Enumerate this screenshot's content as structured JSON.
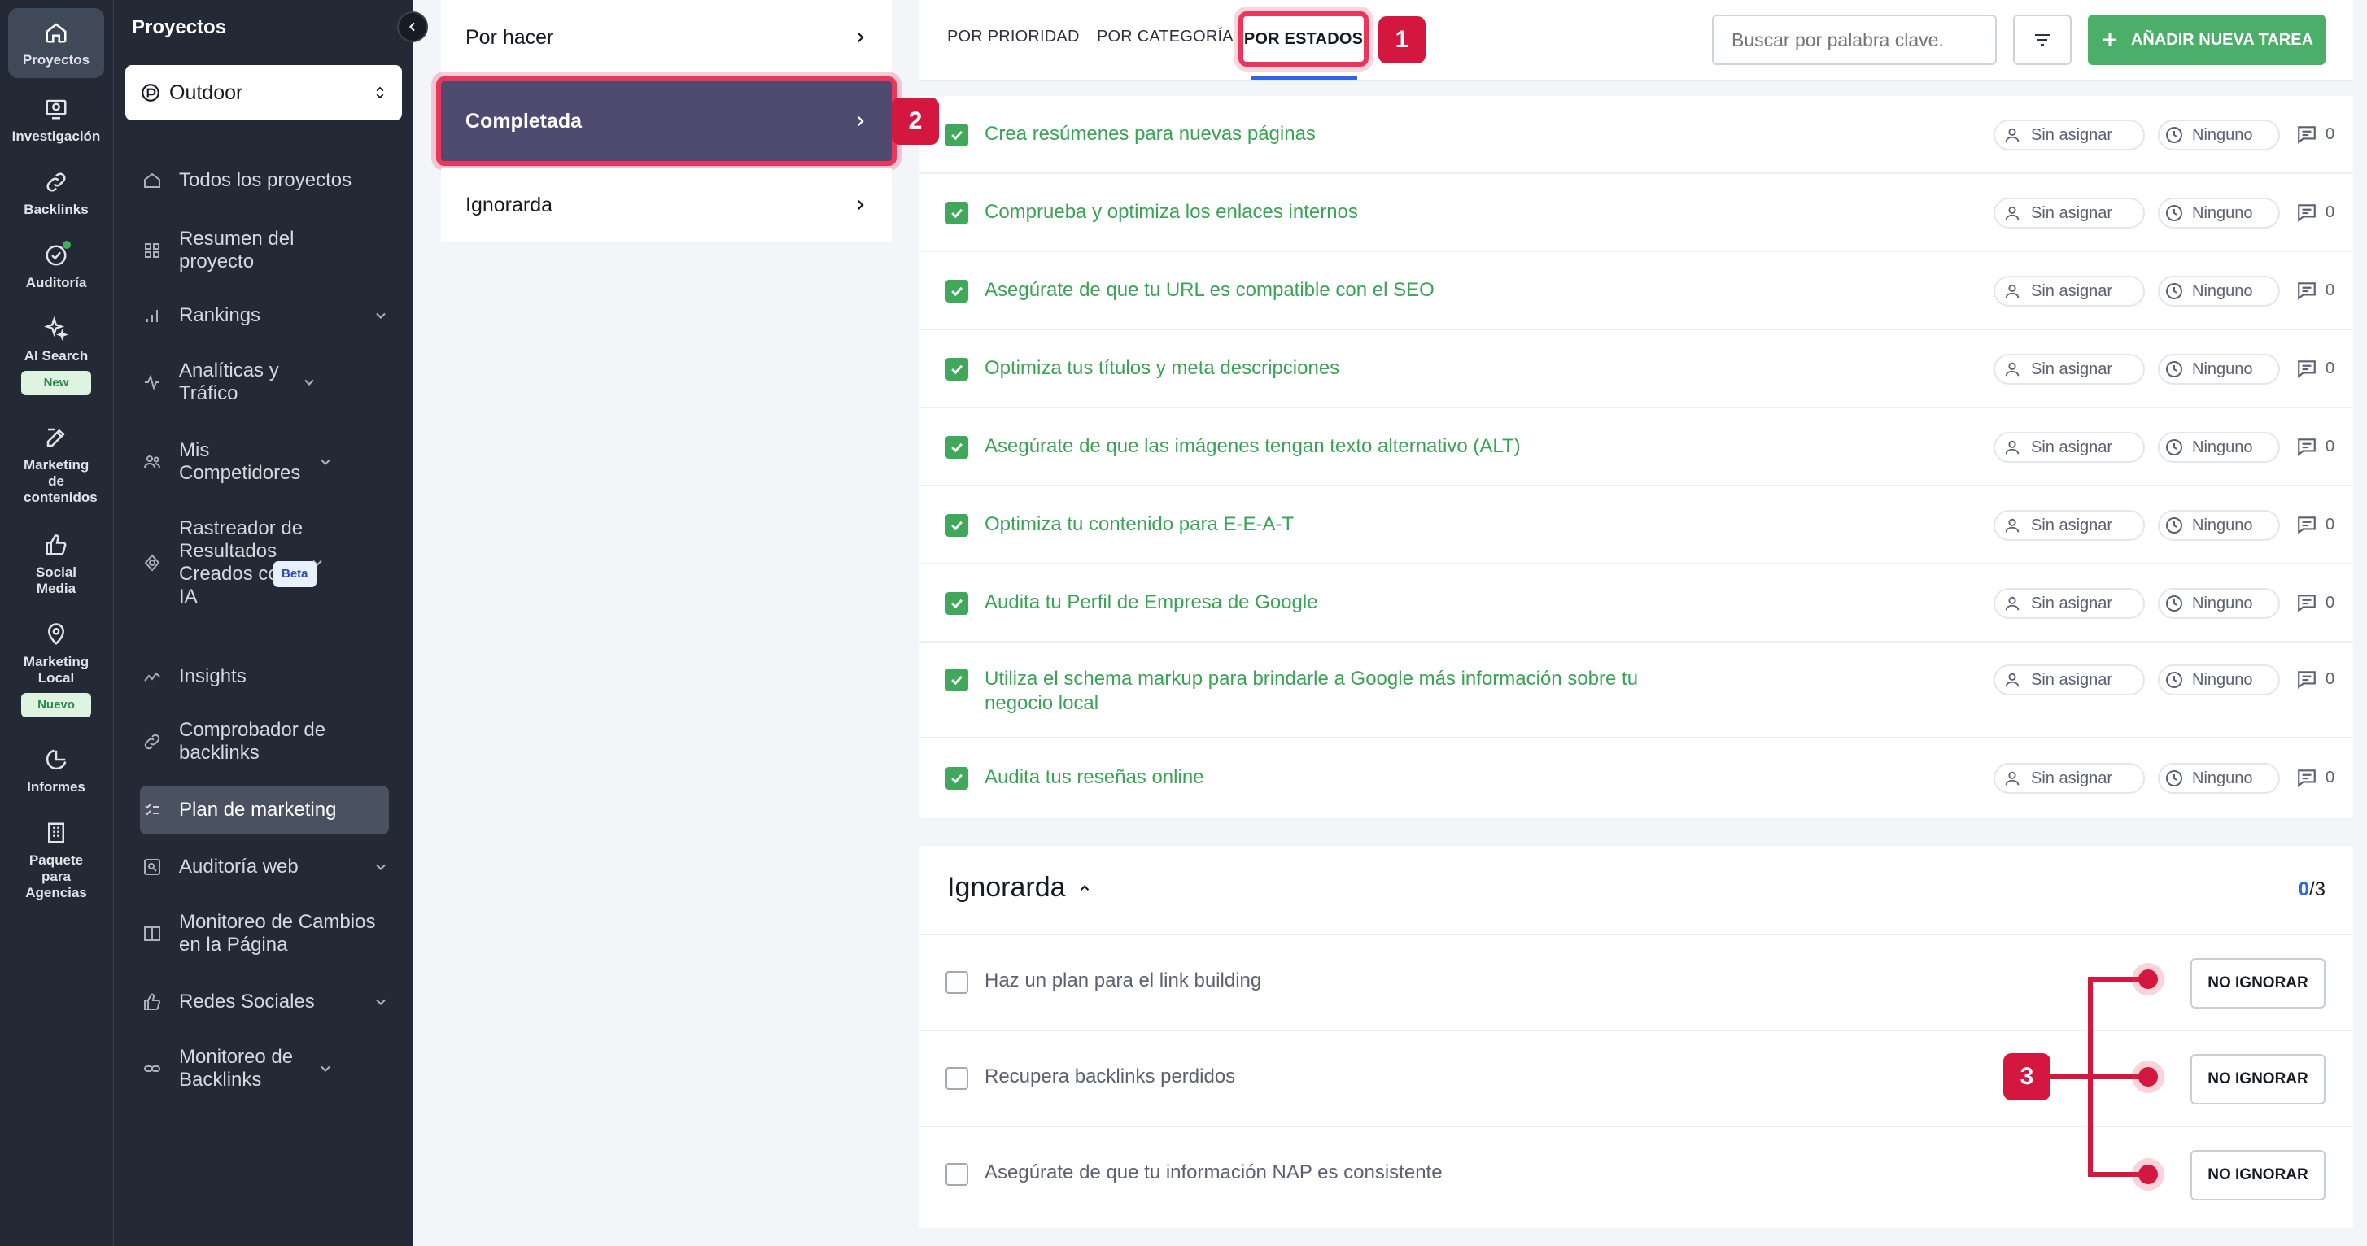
{
  "rail": {
    "items": [
      {
        "label": "Proyectos",
        "icon": "home-icon",
        "active": true
      },
      {
        "label": "Investigación",
        "icon": "research-icon"
      },
      {
        "label": "Backlinks",
        "icon": "link-icon"
      },
      {
        "label": "Auditoría",
        "icon": "audit-check-icon"
      },
      {
        "label": "AI Search",
        "icon": "sparkle-icon",
        "badge": "New"
      },
      {
        "label": "Marketing de contenidos",
        "icon": "edit-icon"
      },
      {
        "label": "Social Media",
        "icon": "thumbs-up-icon"
      },
      {
        "label": "Marketing Local",
        "icon": "map-pin-icon",
        "badge": "Nuevo"
      },
      {
        "label": "Informes",
        "icon": "pie-chart-icon"
      },
      {
        "label": "Paquete para Agencias",
        "icon": "building-icon"
      }
    ]
  },
  "sidebar": {
    "title": "Proyectos",
    "project": "Outdoor",
    "items": [
      {
        "label": "Todos los proyectos"
      },
      {
        "label": "Resumen del proyecto"
      },
      {
        "label": "Rankings"
      },
      {
        "label": "Analíticas y Tráfico"
      },
      {
        "label": "Mis Competidores"
      },
      {
        "label": "Rastreador de Resultados Creados con IA",
        "badge": "Beta"
      },
      {
        "label": "Insights"
      },
      {
        "label": "Comprobador de backlinks"
      },
      {
        "label": "Plan de marketing"
      },
      {
        "label": "Auditoría web"
      },
      {
        "label": "Monitoreo de Cambios en la Página"
      },
      {
        "label": "Redes Sociales"
      },
      {
        "label": "Monitoreo de Backlinks"
      }
    ]
  },
  "statuses": [
    {
      "label": "Por hacer"
    },
    {
      "label": "Completada",
      "selected": true
    },
    {
      "label": "Ignorarda"
    }
  ],
  "toolbar": {
    "tabs": [
      "POR PRIORIDAD",
      "POR CATEGORÍA",
      "POR ESTADOS"
    ],
    "active_tab": "POR ESTADOS",
    "search_placeholder": "Buscar por palabra clave.",
    "add_label": "AÑADIR NUEVA TAREA"
  },
  "callouts": [
    "1",
    "2",
    "3"
  ],
  "completed_tasks": [
    {
      "title": "Crea resúmenes para nuevas páginas",
      "assignee": "Sin asignar",
      "due": "Ninguno",
      "comments": "0"
    },
    {
      "title": "Comprueba y optimiza los enlaces internos",
      "assignee": "Sin asignar",
      "due": "Ninguno",
      "comments": "0"
    },
    {
      "title": "Asegúrate de que tu URL es compatible con el SEO",
      "assignee": "Sin asignar",
      "due": "Ninguno",
      "comments": "0"
    },
    {
      "title": "Optimiza tus títulos y meta descripciones",
      "assignee": "Sin asignar",
      "due": "Ninguno",
      "comments": "0"
    },
    {
      "title": "Asegúrate de que las imágenes tengan texto alternativo (ALT)",
      "assignee": "Sin asignar",
      "due": "Ninguno",
      "comments": "0"
    },
    {
      "title": "Optimiza tu contenido para E-E-A-T",
      "assignee": "Sin asignar",
      "due": "Ninguno",
      "comments": "0"
    },
    {
      "title": "Audita tu Perfil de Empresa de Google",
      "assignee": "Sin asignar",
      "due": "Ninguno",
      "comments": "0"
    },
    {
      "title": "Utiliza el schema markup para brindarle a Google más información sobre tu negocio local",
      "assignee": "Sin asignar",
      "due": "Ninguno",
      "comments": "0"
    },
    {
      "title": "Audita tus reseñas online",
      "assignee": "Sin asignar",
      "due": "Ninguno",
      "comments": "0"
    }
  ],
  "ignored": {
    "title": "Ignorarda",
    "count_done": "0",
    "count_total": "/3",
    "button_label": "NO IGNORAR",
    "tasks": [
      {
        "title": "Haz un plan para el link building"
      },
      {
        "title": "Recupera backlinks perdidos"
      },
      {
        "title": "Asegúrate de que tu información NAP es consistente"
      }
    ]
  },
  "colors": {
    "accent_red": "#d3173f",
    "success_green": "#3fa85a",
    "sidebar_bg": "#232a35",
    "selected_status": "#4f4a6f"
  }
}
